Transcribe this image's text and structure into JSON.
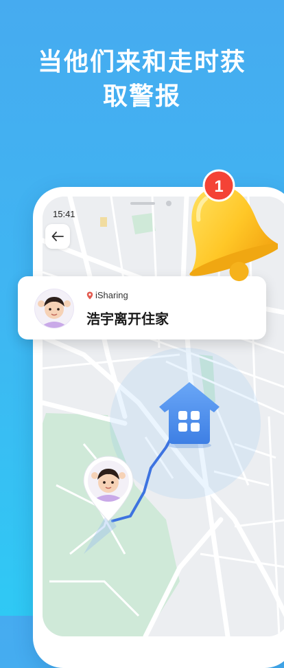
{
  "headline": {
    "line1": "当他们来和走时获",
    "line2": "取警报"
  },
  "status_bar": {
    "time": "15:41"
  },
  "notification": {
    "brand": "iSharing",
    "message": "浩宇离开住家",
    "badge_count": "1"
  },
  "icons": {
    "back": "arrow-left-icon",
    "bell": "bell-icon",
    "home": "house-icon",
    "location": "location-pin-icon"
  },
  "colors": {
    "background": "#46abf0",
    "route": "#3d73e0",
    "house": "#4a8ff0",
    "bell": "#ffcf2e",
    "badge": "#f44336"
  }
}
